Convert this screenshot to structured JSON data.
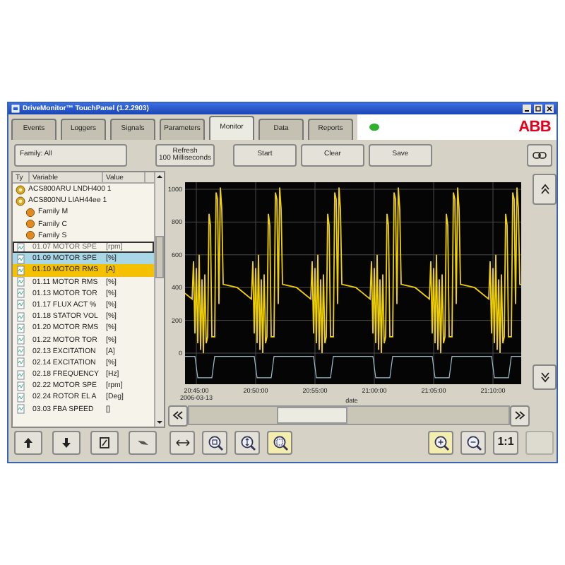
{
  "window": {
    "title": "DriveMonitor™ TouchPanel (1.2.2903)"
  },
  "tabs": [
    {
      "label": "Events",
      "selected": false
    },
    {
      "label": "Loggers",
      "selected": false
    },
    {
      "label": "Signals",
      "selected": false
    },
    {
      "label": "Parameters",
      "selected": false
    },
    {
      "label": "Monitor",
      "selected": true
    },
    {
      "label": "Data",
      "selected": false
    },
    {
      "label": "Reports",
      "selected": false
    }
  ],
  "header": {
    "status_on": true,
    "logo": "ABB"
  },
  "toolbar": {
    "family_field": "Family: All",
    "refresh": [
      "Refresh",
      "100 Milliseconds"
    ],
    "buttons": [
      "Start",
      "Clear",
      "Save"
    ]
  },
  "list_columns": [
    "Ty",
    "Variable",
    "Value"
  ],
  "tree": [
    {
      "label": "ACS800ARU LNDH400 1"
    },
    {
      "label": "ACS800NU LIAH44ee 1",
      "children": [
        {
          "label": "Family M"
        },
        {
          "label": "Family C"
        },
        {
          "label": "Family S"
        }
      ]
    }
  ],
  "signals": [
    {
      "variable": "01.07 MOTOR SPE",
      "value": "[rpm]",
      "selected": false,
      "focused": true,
      "highlighted": false
    },
    {
      "variable": "01.09 MOTOR SPE",
      "value": "[%]",
      "selected": true,
      "focused": false,
      "highlighted": false
    },
    {
      "variable": "01.10 MOTOR RMS",
      "value": "[A]",
      "selected": false,
      "focused": false,
      "highlighted": true
    },
    {
      "variable": "01.11 MOTOR RMS",
      "value": "[%]",
      "selected": false,
      "focused": false,
      "highlighted": false
    },
    {
      "variable": "01.13 MOTOR TOR",
      "value": "[%]",
      "selected": false,
      "focused": false,
      "highlighted": false
    },
    {
      "variable": "01.17 FLUX ACT %",
      "value": "[%]",
      "selected": false,
      "focused": false,
      "highlighted": false
    },
    {
      "variable": "01.18 STATOR VOL",
      "value": "[%]",
      "selected": false,
      "focused": false,
      "highlighted": false
    },
    {
      "variable": "01.20 MOTOR RMS",
      "value": "[%]",
      "selected": false,
      "focused": false,
      "highlighted": false
    },
    {
      "variable": "01.22 MOTOR TOR",
      "value": "[%]",
      "selected": false,
      "focused": false,
      "highlighted": false
    },
    {
      "variable": "02.13 EXCITATION",
      "value": "[A]",
      "selected": false,
      "focused": false,
      "highlighted": false
    },
    {
      "variable": "02.14 EXCITATION",
      "value": "[%]",
      "selected": false,
      "focused": false,
      "highlighted": false
    },
    {
      "variable": "02.18 FREQUENCY",
      "value": "[Hz]",
      "selected": false,
      "focused": false,
      "highlighted": false
    },
    {
      "variable": "02.22 MOTOR SPE",
      "value": "[rpm]",
      "selected": false,
      "focused": false,
      "highlighted": false
    },
    {
      "variable": "02.24 ROTOR EL A",
      "value": "[Deg]",
      "selected": false,
      "focused": false,
      "highlighted": false
    },
    {
      "variable": "03.03 FBA SPEED",
      "value": "[]",
      "selected": false,
      "focused": false,
      "highlighted": false
    }
  ],
  "list_buttons": [
    {
      "kind": "up"
    },
    {
      "kind": "down"
    },
    {
      "kind": "edit"
    },
    {
      "kind": "erase"
    }
  ],
  "chart": {
    "y_ticks": [
      "1000",
      "800",
      "600",
      "400",
      "200",
      "0"
    ],
    "x_ticks": [
      "20:45:00",
      "20:50:00",
      "20:55:00",
      "21:00:00",
      "21:05:00",
      "21:10:00"
    ],
    "date": "2006-03-13",
    "x_title": "date",
    "traces": [
      {
        "color": "#f0d000"
      },
      {
        "color": "#9fbccc"
      }
    ]
  },
  "chart_tools": [
    {
      "kind": "pan",
      "active": false
    },
    {
      "kind": "zoom-fit",
      "active": false
    },
    {
      "kind": "zoom-vertical",
      "active": false
    },
    {
      "kind": "zoom-rect",
      "active": true
    },
    {
      "kind": "spacer"
    },
    {
      "kind": "zoom-in",
      "active": true
    },
    {
      "kind": "zoom-out",
      "active": false
    },
    {
      "kind": "reset",
      "label": "1:1",
      "active": false
    },
    {
      "kind": "blank",
      "active": false
    }
  ]
}
